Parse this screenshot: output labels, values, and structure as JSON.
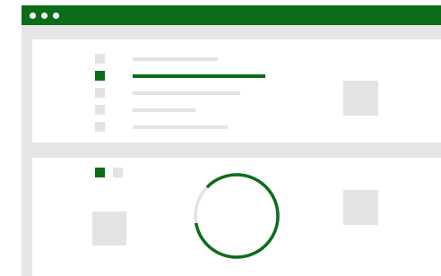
{
  "titlebar": {
    "color": "#0c6d18",
    "window_controls": [
      "dot",
      "dot",
      "dot"
    ]
  },
  "list": {
    "items": [
      {
        "selected": false
      },
      {
        "selected": true
      },
      {
        "selected": false
      },
      {
        "selected": false
      },
      {
        "selected": false
      }
    ]
  },
  "tabs": [
    {
      "selected": true
    },
    {
      "selected": false
    }
  ],
  "progress": {
    "fraction": 0.85,
    "color": "#0c6d18",
    "track_color": "#e3e3e3"
  },
  "colors": {
    "accent": "#0c6d18",
    "placeholder": "#e3e3e3",
    "background": "#e6e6e6"
  }
}
